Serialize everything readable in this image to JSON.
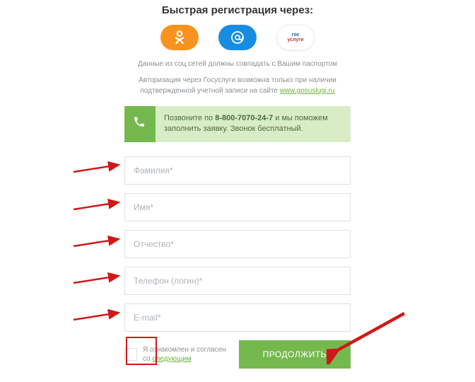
{
  "title": "Быстрая регистрация через:",
  "social": {
    "ok": "Одноклассники",
    "mail": "Mail.ru",
    "gos_line1": "гос",
    "gos_line2": "услуги"
  },
  "note_passport": "Данные из соц.сетей должны совпадать с Вашим паспортом",
  "note_gos_line1": "Авторизация через Госуслуги возможна только при наличии",
  "note_gos_line2_prefix": "подтвержденной учетной записи на сайте ",
  "note_gos_link": "www.gosuslugi.ru",
  "callbox_text_prefix": "Позвоните по ",
  "callbox_phone": "8-800-7070-24-7",
  "callbox_text_suffix": " и мы поможем заполнить заявку. Звонок бесплатный.",
  "fields": {
    "lastname": "Фамилия*",
    "firstname": "Имя*",
    "patronymic": "Отчество*",
    "phone": "Телефон (логин)*",
    "email": "E-mail*"
  },
  "consent_prefix": "Я ознакомлен и согласен",
  "consent_link_prefix": "со ",
  "consent_link": "следующим",
  "continue": "ПРОДОЛЖИТЬ"
}
